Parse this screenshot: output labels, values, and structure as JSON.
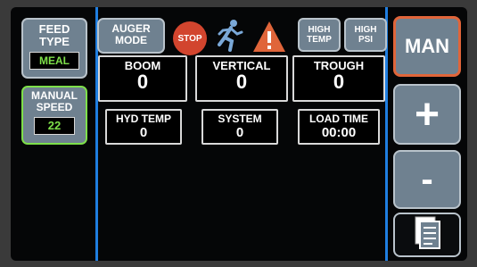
{
  "left_panel": {
    "feed_type": {
      "title": "FEED\nTYPE",
      "value": "MEAL"
    },
    "manual_speed": {
      "title": "MANUAL\nSPEED",
      "value": "22"
    }
  },
  "top_bar": {
    "auger_mode_label": "AUGER\nMODE",
    "stop_label": "STOP",
    "high_temp_label": "HIGH\nTEMP",
    "high_psi_label": "HIGH\nPSI"
  },
  "readouts": {
    "boom": {
      "label": "BOOM",
      "value": "0"
    },
    "vertical": {
      "label": "VERTICAL",
      "value": "0"
    },
    "trough": {
      "label": "TROUGH",
      "value": "0"
    },
    "hyd_temp": {
      "label": "HYD TEMP",
      "value": "0"
    },
    "system": {
      "label": "SYSTEM",
      "value": "0"
    },
    "load_time": {
      "label": "LOAD TIME",
      "value": "00:00"
    }
  },
  "right_panel": {
    "man_label": "MAN",
    "plus_label": "+",
    "minus_label": "-"
  },
  "colors": {
    "accent_blue": "#1f7ee0",
    "meal_green": "#7ee04a",
    "speed_green": "#7ee04a",
    "man_orange": "#e0653a",
    "stop_red": "#d2452e",
    "warning_orange": "#e0653a",
    "tile_slate": "#6f8190"
  }
}
